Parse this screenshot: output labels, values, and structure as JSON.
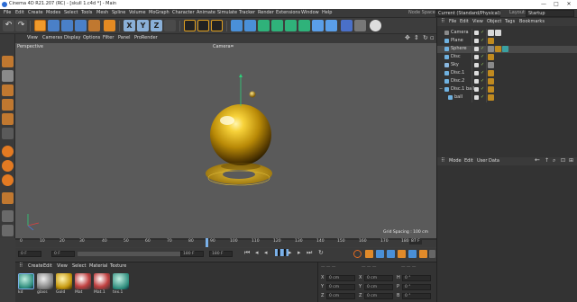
{
  "window": {
    "title": "Cinema 4D R21.207 (RC) - [skull 1.c4d *] - Main",
    "minimize": "—",
    "maximize": "□",
    "close": "✕"
  },
  "menu": [
    "File",
    "Edit",
    "Create",
    "Modes",
    "Select",
    "Tools",
    "Mesh",
    "Spline",
    "Volume",
    "MoGraph",
    "Character",
    "Animate",
    "Simulate",
    "Tracker",
    "Render",
    "Extensions",
    "Window",
    "Help"
  ],
  "node_space": {
    "label": "Node Space:",
    "value": "Current (Standard/Physical)"
  },
  "layout": {
    "label": "Layout:",
    "value": "Startup"
  },
  "viewport": {
    "menu": [
      "View",
      "Cameras",
      "Display",
      "Options",
      "Filter",
      "Panel",
      "ProRender"
    ],
    "name": "Perspective",
    "camera": "Camera",
    "grid_spacing": "Grid Spacing : 100 cm"
  },
  "object_manager": {
    "menu": [
      "File",
      "Edit",
      "View",
      "Object",
      "Tags",
      "Bookmarks"
    ],
    "objects": [
      {
        "name": "Camera"
      },
      {
        "name": "Plane"
      },
      {
        "name": "Sphere"
      },
      {
        "name": "Disc"
      },
      {
        "name": "Sky"
      },
      {
        "name": "Disc.1"
      },
      {
        "name": "Disc.2"
      },
      {
        "name": "Disc.1 balls"
      },
      {
        "name": "ball"
      }
    ]
  },
  "attribute_manager": {
    "menu": [
      "Mode",
      "Edit",
      "User Data"
    ]
  },
  "timeline": {
    "ticks": [
      "0",
      "10",
      "20",
      "30",
      "40",
      "50",
      "60",
      "70",
      "80",
      "90",
      "100",
      "110",
      "120",
      "130",
      "140",
      "150",
      "160",
      "170",
      "180"
    ],
    "current_frame": "87 F"
  },
  "controls": {
    "start": "0 F",
    "current": "0 F",
    "end_inner": "180 F",
    "end": "180 F"
  },
  "material_manager": {
    "menu": [
      "Create",
      "Edit",
      "View",
      "Select",
      "Material",
      "Texture"
    ],
    "materials": [
      {
        "name": "kd"
      },
      {
        "name": "glass"
      },
      {
        "name": "Gold"
      },
      {
        "name": "Mat"
      },
      {
        "name": "Mat.1"
      },
      {
        "name": "tex.1"
      }
    ]
  },
  "coordinates": {
    "rows": [
      {
        "axis": "X",
        "pos": "0 cm",
        "axis2": "X",
        "size": "0 cm",
        "axis3": "H",
        "rot": "0 °"
      },
      {
        "axis": "Y",
        "pos": "0 cm",
        "axis2": "Y",
        "size": "0 cm",
        "axis3": "P",
        "rot": "0 °"
      },
      {
        "axis": "Z",
        "pos": "0 cm",
        "axis2": "Z",
        "size": "0 cm",
        "axis3": "B",
        "rot": "0 °"
      }
    ]
  }
}
